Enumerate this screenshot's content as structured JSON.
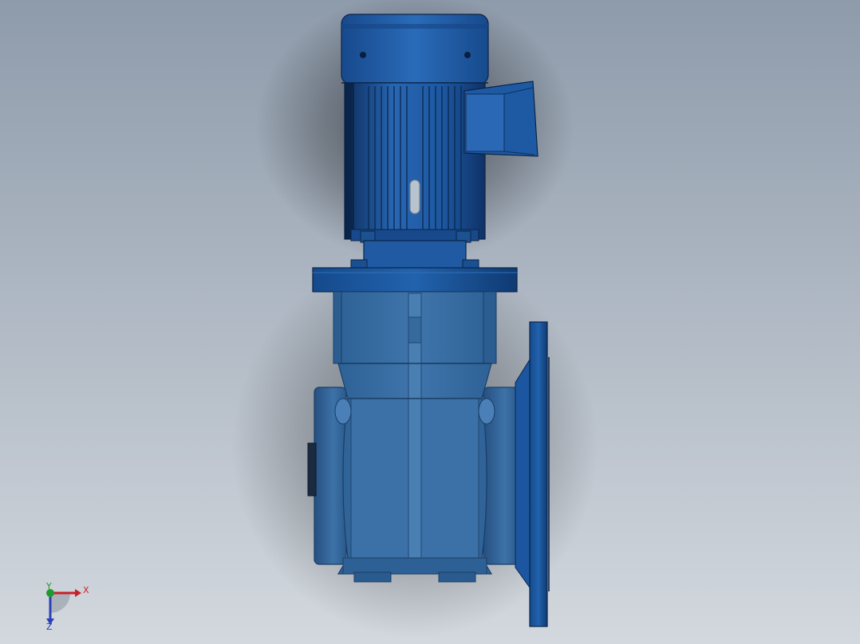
{
  "viewport": {
    "background_top": "#8e9bab",
    "background_bottom": "#d3d8de"
  },
  "model": {
    "motor_color": "#1f5ea8",
    "motor_dark": "#12407a",
    "gearbox_color": "#3a6fa3",
    "gearbox_dark": "#244f7c",
    "gearbox_light": "#5a8ec0",
    "flange_color": "#1c58a0"
  },
  "triad": {
    "x_label": "X",
    "y_label": "Y",
    "z_label": "Z",
    "x_color": "#c8202a",
    "y_color": "#1f9a2e",
    "z_color": "#2a3fb8"
  }
}
